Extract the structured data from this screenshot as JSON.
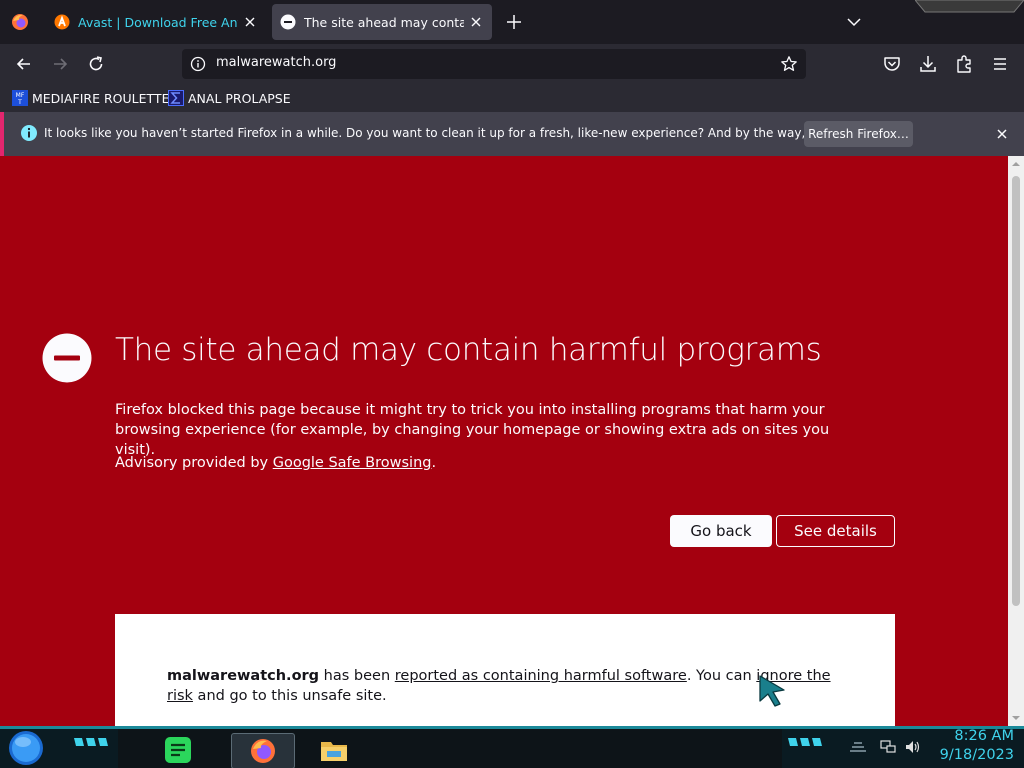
{
  "tabs": [
    {
      "title": "Avast | Download Free Antivirus",
      "favicon": "avast-icon"
    },
    {
      "title": "The site ahead may contain harmful programs",
      "favicon": "blocked-icon",
      "active": true
    }
  ],
  "navbar": {
    "url": "malwarewatch.org"
  },
  "bookmarks": [
    {
      "label": "MEDIAFIRE ROULETTER",
      "icon": "mft-icon"
    },
    {
      "label": "ANAL PROLAPSE",
      "icon": "sigma-icon"
    }
  ],
  "notification": {
    "message": "It looks like you haven’t started Firefox in a while. Do you want to clean it up for a fresh, like-new experience? And by the way, welcome back!",
    "button": "Refresh Firefox…"
  },
  "error_page": {
    "title": "The site ahead may contain harmful programs",
    "description": "Firefox blocked this page because it might try to trick you into installing programs that harm your browsing experience (for example, by changing your homepage or showing extra ads on sites you visit).",
    "advisory_prefix": "Advisory provided by ",
    "advisory_link": "Google Safe Browsing",
    "advisory_suffix": ".",
    "go_back": "Go back",
    "see_details": "See details",
    "details": {
      "domain": "malwarewatch.org",
      "text1": " has been ",
      "link1": "reported as containing harmful software",
      "text2": ". You can ",
      "link2": "ignore the risk",
      "text3": " and go to this unsafe site."
    }
  },
  "taskbar": {
    "time": "8:26 AM",
    "date": "9/18/2023",
    "apps": [
      "notes-icon",
      "firefox-icon",
      "file-explorer-icon"
    ]
  },
  "colors": {
    "error_bg": "#a4000f",
    "accent_cyan": "#3fd3ec",
    "notification_bar": "#e3266e",
    "toolbar": "#2b2a33",
    "tabstrip": "#1c1b22"
  }
}
